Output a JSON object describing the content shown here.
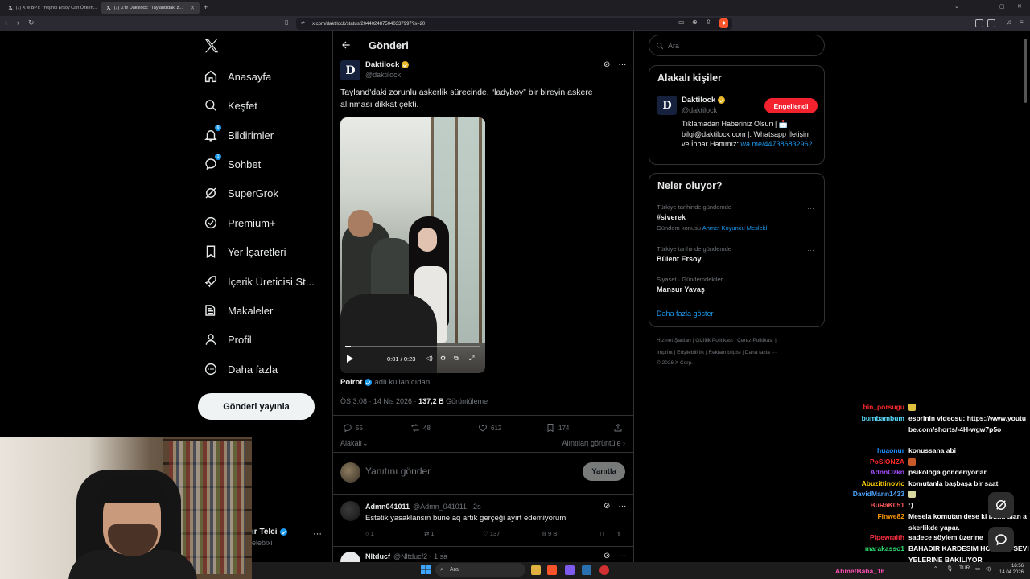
{
  "browser": {
    "tabs": [
      {
        "label": "(7) X'te BPT: \"Yeşinci Ersoy Can Özken..."
      },
      {
        "label": "(7) X'te Daktilock: \"Tayland'daki z..."
      }
    ],
    "url": "x.com/daktilock/status/2044024875040337997?s=20"
  },
  "nav": {
    "items": [
      {
        "label": "Anasayfa",
        "icon": "home-icon"
      },
      {
        "label": "Keşfet",
        "icon": "search-icon"
      },
      {
        "label": "Bildirimler",
        "icon": "bell-icon",
        "badge": "6"
      },
      {
        "label": "Sohbet",
        "icon": "chat-icon",
        "badge": "1"
      },
      {
        "label": "SuperGrok",
        "icon": "grok-icon"
      },
      {
        "label": "Premium+",
        "icon": "premium-icon"
      },
      {
        "label": "Yer İşaretleri",
        "icon": "bookmark-icon"
      },
      {
        "label": "İçerik Üreticisi St...",
        "icon": "rocket-icon"
      },
      {
        "label": "Makaleler",
        "icon": "article-icon"
      },
      {
        "label": "Profil",
        "icon": "person-icon"
      },
      {
        "label": "Daha fazla",
        "icon": "more-circle-icon"
      }
    ],
    "post_button": "Gönderi yayınla",
    "account_name": "ır Telci",
    "account_handle": "elebixi"
  },
  "post": {
    "header_title": "Gönderi",
    "author": "Daktilock",
    "handle": "@daktilock",
    "avatar_letter": "D",
    "text": "Tayland'daki zorunlu askerlik sürecinde, “ladyboy” bir bireyin askere alınması dikkat çekti.",
    "video": {
      "time": "0:01 / 0:23",
      "progress": 0.04
    },
    "credit_name": "Poirot",
    "credit_suffix": "adlı kullanıcıdan",
    "timestamp": "ÖS 3:08 · 14 Nis 2026 · ",
    "views": "137,2 B",
    "views_label": " Görüntüleme",
    "stats": {
      "replies": "55",
      "reposts": "48",
      "likes": "612",
      "bookmarks": "174"
    },
    "related_label": "Alakalı",
    "quotes_label": "Alıntıları görüntüle",
    "reply_placeholder": "Yanıtını gönder",
    "reply_button": "Yanıtla"
  },
  "comments": [
    {
      "name": "Admn041011",
      "handle": "@Admn_041011 · 2s",
      "text": "Estetik yasaklansın bune aq artık gerçeği ayırt edemiyorum",
      "replies": "1",
      "reposts": "1",
      "likes": "137",
      "views": "9 B"
    },
    {
      "name": "Nltducf",
      "handle": "@Nltducf2 · 1 sa",
      "text": ""
    }
  ],
  "sidebar": {
    "search_placeholder": "Ara",
    "related_title": "Alakalı kişiler",
    "person_name": "Daktilock",
    "person_handle": "@daktilock",
    "person_button": "Engellendi",
    "person_bio": "Tıklamadan Haberiniz Olsun | 📩 bilgi@daktilock.com |. Whatsapp İletişim ve İhbar Hattımız:",
    "person_link": "wa.me/447386832962",
    "trends_title": "Neler oluyor?",
    "trends": [
      {
        "category": "Türkiye tarihinde gündemde",
        "name": "#siverek",
        "sub_prefix": "Gündem konusu ",
        "sub_link": "Ahmet Koyuncu Meslekl"
      },
      {
        "category": "Türkiye tarihinde gündemde",
        "name": "Bülent Ersoy",
        "sub_prefix": "",
        "sub_link": ""
      },
      {
        "category": "Siyaset · Gündemdekiler",
        "name": "Mansur Yavaş",
        "sub_prefix": "",
        "sub_link": ""
      }
    ],
    "show_more": "Daha fazla göster",
    "footer_line1": "Hizmet Şartları  |  Gizlilik Politikası  |  Çerez Politikası  |",
    "footer_line2": "Imprint  |  Erişilebilirlik  |  Reklam bilgisi  |  Daha fazla ···",
    "footer_line3": "© 2026 X Corp."
  },
  "chat": [
    {
      "user": "bin_porsugu",
      "color": "#ff2a2a",
      "text": "",
      "emote": "#e0c040"
    },
    {
      "user": "bumbambum",
      "color": "#5be0ff",
      "text": "esprinin videosu: https://www.youtube.com/shorts/-4H-wgw7p5o"
    },
    {
      "user": "huaonur",
      "color": "#1e90ff",
      "text": "konussana abi"
    },
    {
      "user": "PoSIONZA",
      "color": "#ff2a2a",
      "text": "",
      "emote": "#c85a2a"
    },
    {
      "user": "AdnnOzkn",
      "color": "#a64dff",
      "text": "psikoloğa gönderiyorlar"
    },
    {
      "user": "Abuzittinovic",
      "color": "#ffd000",
      "text": "komutanla başbaşa bir saat"
    },
    {
      "user": "DavidMann1433",
      "color": "#4da6ff",
      "text": "",
      "emote": "#d8d8a0"
    },
    {
      "user": "BuRaK051",
      "color": "#ff5a5a",
      "text": ":)"
    },
    {
      "user": "Finwe82",
      "color": "#ff9900",
      "text": "Mesela komutan dese ki bunu alan askerlikde yapar."
    },
    {
      "user": "Pipewraith",
      "color": "#ff3040",
      "text": "sadece söylem üzerine"
    },
    {
      "user": "marakasso1",
      "color": "#30e070",
      "text": "BAHADIR KARDESIM HORMON SEVIYELERINE BAKILIYOR"
    }
  ],
  "chat_bottom_user": "AhmetBaba_16",
  "taskbar": {
    "search": "Ara",
    "lang": "TUR",
    "time": "18:56",
    "date": "14.04.2026"
  }
}
